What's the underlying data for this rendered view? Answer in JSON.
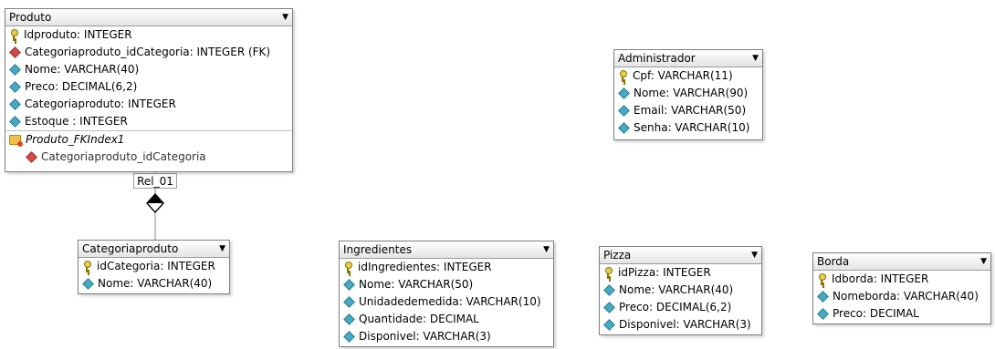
{
  "entities": {
    "produto": {
      "title": "Produto",
      "fields": [
        {
          "icon": "key",
          "text": "Idproduto: INTEGER"
        },
        {
          "icon": "fk",
          "text": "Categoriaproduto_idCategoria: INTEGER (FK)"
        },
        {
          "icon": "attr",
          "text": "Nome: VARCHAR(40)"
        },
        {
          "icon": "attr",
          "text": "Preco: DECIMAL(6,2)"
        },
        {
          "icon": "attr",
          "text": "Categoriaproduto: INTEGER"
        },
        {
          "icon": "attr",
          "text": "Estoque : INTEGER"
        }
      ],
      "index_name": "Produto_FKIndex1",
      "index_column": "Categoriaproduto_idCategoria"
    },
    "administrador": {
      "title": "Administrador",
      "fields": [
        {
          "icon": "key",
          "text": "Cpf: VARCHAR(11)"
        },
        {
          "icon": "attr",
          "text": "Nome: VARCHAR(90)"
        },
        {
          "icon": "attr",
          "text": "Email: VARCHAR(50)"
        },
        {
          "icon": "attr",
          "text": "Senha: VARCHAR(10)"
        }
      ]
    },
    "categoriaproduto": {
      "title": "Categoriaproduto",
      "fields": [
        {
          "icon": "key",
          "text": "idCategoria: INTEGER"
        },
        {
          "icon": "attr",
          "text": "Nome: VARCHAR(40)"
        }
      ]
    },
    "ingredientes": {
      "title": "Ingredientes",
      "fields": [
        {
          "icon": "key",
          "text": "idIngredientes: INTEGER"
        },
        {
          "icon": "attr",
          "text": "Nome: VARCHAR(50)"
        },
        {
          "icon": "attr",
          "text": "Unidadedemedida: VARCHAR(10)"
        },
        {
          "icon": "attr",
          "text": "Quantidade: DECIMAL"
        },
        {
          "icon": "attr",
          "text": "Disponivel: VARCHAR(3)"
        }
      ]
    },
    "pizza": {
      "title": "Pizza",
      "fields": [
        {
          "icon": "key",
          "text": "idPizza: INTEGER"
        },
        {
          "icon": "attr",
          "text": "Nome: VARCHAR(40)"
        },
        {
          "icon": "attr",
          "text": "Preco: DECIMAL(6,2)"
        },
        {
          "icon": "attr",
          "text": "Disponivel: VARCHAR(3)"
        }
      ]
    },
    "borda": {
      "title": "Borda",
      "fields": [
        {
          "icon": "key",
          "text": "Idborda: INTEGER"
        },
        {
          "icon": "attr",
          "text": "Nomeborda: VARCHAR(40)"
        },
        {
          "icon": "attr",
          "text": "Preco: DECIMAL"
        }
      ]
    }
  },
  "relationships": [
    {
      "label": "Rel_01",
      "from": "Categoriaproduto",
      "to": "Produto"
    }
  ],
  "icons": {
    "caret": "▼",
    "key": "primary-key-icon",
    "fk": "foreign-key-icon",
    "attr": "attribute-icon",
    "index": "index-folder-icon"
  }
}
